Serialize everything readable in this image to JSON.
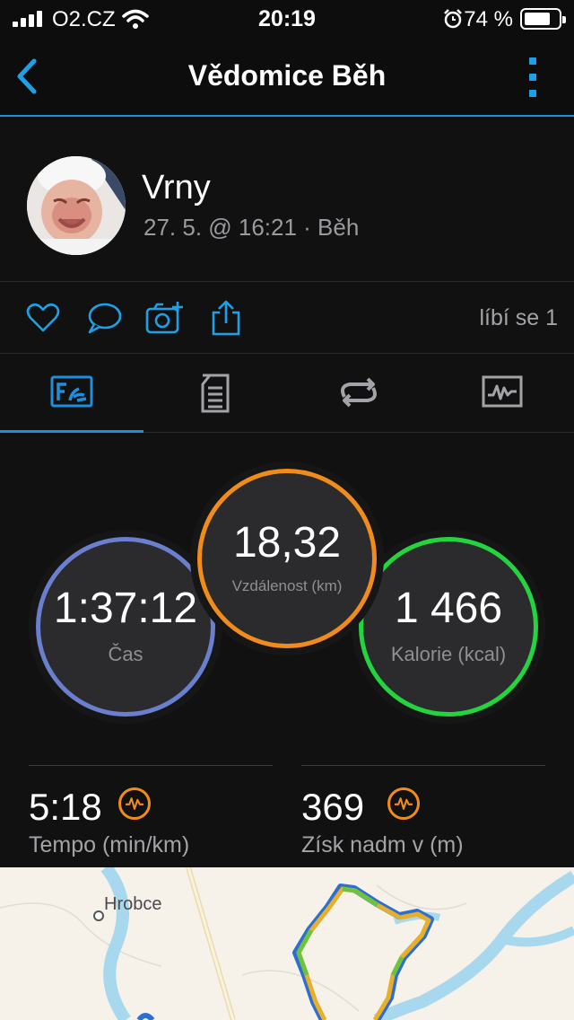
{
  "status_bar": {
    "carrier": "O2.CZ",
    "time": "20:19",
    "battery": "74 %",
    "battery_level": 0.74
  },
  "nav": {
    "title": "Vědomice Běh"
  },
  "profile": {
    "name": "Vrny",
    "meta": "27. 5. @ 16:21 · Běh"
  },
  "actions": {
    "likes_label": "líbí se 1"
  },
  "stats": {
    "time": {
      "value": "1:37:12",
      "label": "Čas"
    },
    "distance": {
      "value": "18,32",
      "label": "Vzdálenost (km)"
    },
    "calories": {
      "value": "1 466",
      "label": "Kalorie (kcal)"
    },
    "pace": {
      "value": "5:18",
      "label": "Tempo (min/km)"
    },
    "elevation": {
      "value": "369",
      "label": "Získ nadm v (m)"
    }
  },
  "map": {
    "town": "Hrobce"
  },
  "colors": {
    "accent": "#1e8fd8",
    "time_ring": "#6b7fcf",
    "distance_ring": "#f08c1c",
    "calories_ring": "#24d43f"
  }
}
